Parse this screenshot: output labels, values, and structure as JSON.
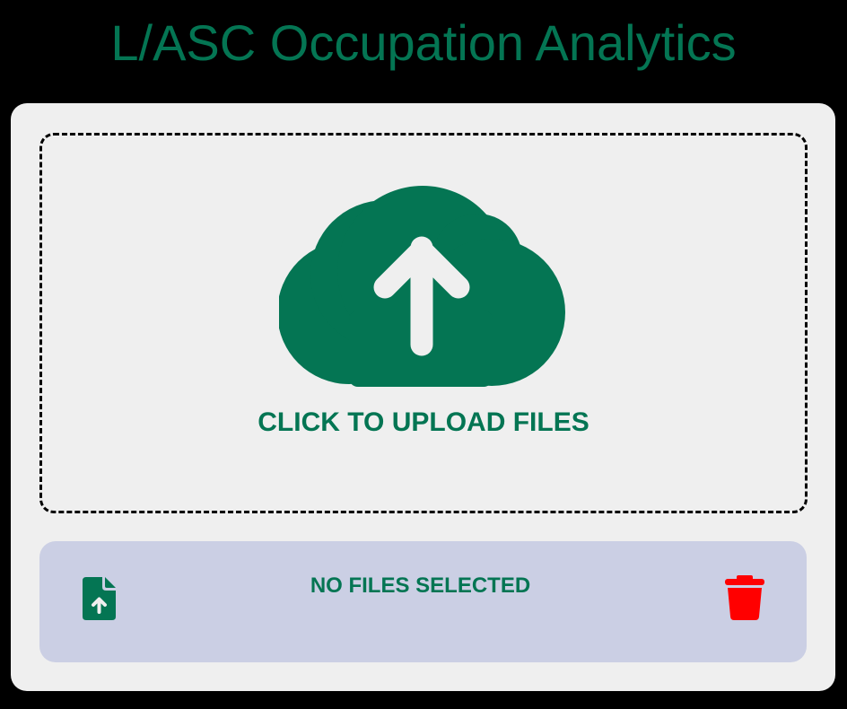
{
  "header": {
    "title": "L/ASC Occupation Analytics"
  },
  "dropzone": {
    "label": "CLICK TO UPLOAD FILES",
    "icon": "cloud-upload-icon"
  },
  "file_bar": {
    "status": "NO FILES SELECTED",
    "file_icon": "file-upload-icon",
    "clear_icon": "trash-icon"
  },
  "colors": {
    "brand_green": "#047553",
    "page_background": "#000000",
    "panel_background": "#efefef",
    "file_bar_background": "#cbcfe4",
    "danger_red": "#ff0000"
  }
}
